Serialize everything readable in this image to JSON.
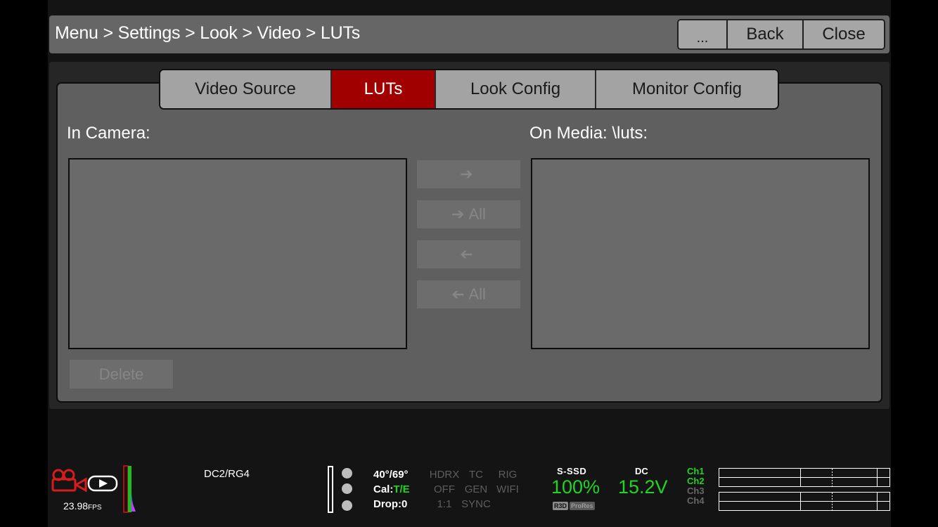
{
  "header": {
    "breadcrumb": "Menu > Settings > Look > Video > LUTs",
    "buttons": {
      "more": "...",
      "back": "Back",
      "close": "Close"
    }
  },
  "tabs": [
    {
      "label": "Video Source",
      "active": false
    },
    {
      "label": "LUTs",
      "active": true
    },
    {
      "label": "Look Config",
      "active": false
    },
    {
      "label": "Monitor Config",
      "active": false
    }
  ],
  "left_list": {
    "label": "In Camera:"
  },
  "right_list": {
    "label": "On Media: \\luts:"
  },
  "transfer_buttons": {
    "to_media": {
      "icon": "arrow-right-icon",
      "label": ""
    },
    "all_to_media": {
      "icon": "arrow-right-icon",
      "label": "All"
    },
    "to_camera": {
      "icon": "arrow-left-icon",
      "label": ""
    },
    "all_to_camera": {
      "icon": "arrow-left-icon",
      "label": "All"
    }
  },
  "delete_button": {
    "label": "Delete"
  },
  "status": {
    "fps_value": "23.98",
    "fps_unit": "FPS",
    "format": "DC2/RG4",
    "temperature": "40°/69°",
    "cal_label": "Cal:",
    "cal_value": "T/E",
    "drop": "Drop:0",
    "modes": [
      "HDRX",
      "TC",
      "RIG",
      "OFF",
      "GEN",
      "WIFI",
      "1:1",
      "SYNC",
      ""
    ],
    "media_label": "S-SSD",
    "media_value": "100%",
    "codecs": [
      "R3D",
      "ProRes"
    ],
    "power_label": "DC",
    "power_value": "15.2V",
    "channels": [
      {
        "label": "Ch1",
        "active": true
      },
      {
        "label": "Ch2",
        "active": true
      },
      {
        "label": "Ch3",
        "active": false
      },
      {
        "label": "Ch4",
        "active": false
      }
    ]
  },
  "colors": {
    "accent_red": "#a00000",
    "status_green": "#21d421",
    "panel_gray": "#5f5f5f"
  }
}
